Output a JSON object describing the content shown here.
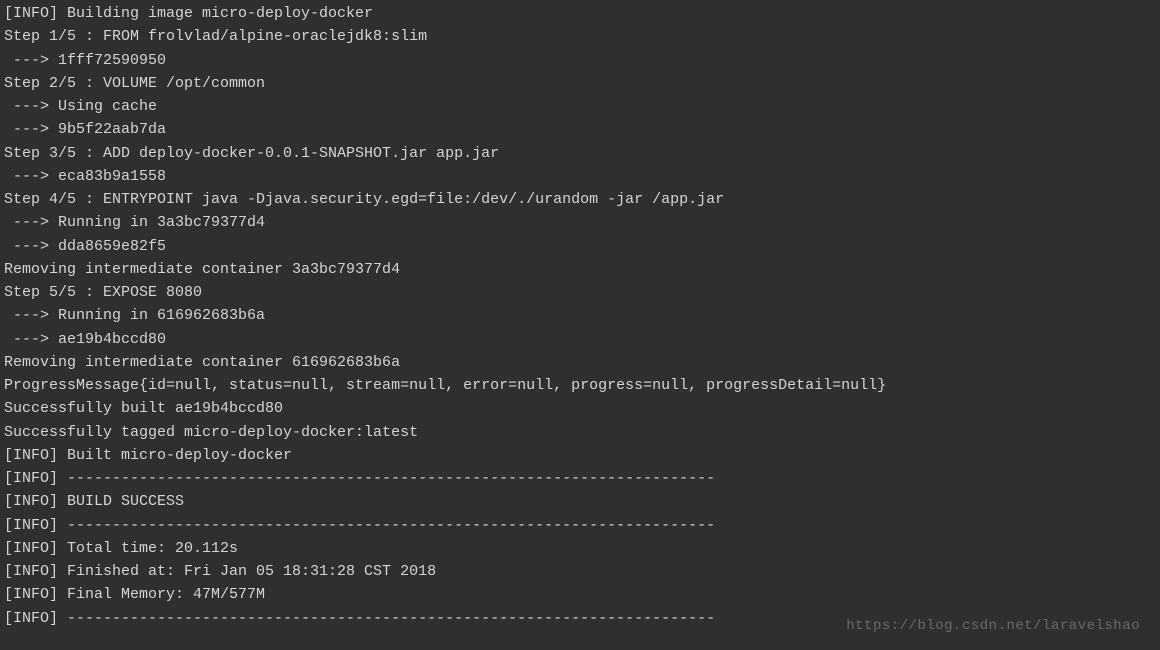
{
  "terminal": {
    "lines": [
      "[INFO] Building image micro-deploy-docker",
      "Step 1/5 : FROM frolvlad/alpine-oraclejdk8:slim",
      " ---> 1fff72590950",
      "Step 2/5 : VOLUME /opt/common",
      " ---> Using cache",
      " ---> 9b5f22aab7da",
      "Step 3/5 : ADD deploy-docker-0.0.1-SNAPSHOT.jar app.jar",
      " ---> eca83b9a1558",
      "Step 4/5 : ENTRYPOINT java -Djava.security.egd=file:/dev/./urandom -jar /app.jar",
      " ---> Running in 3a3bc79377d4",
      " ---> dda8659e82f5",
      "Removing intermediate container 3a3bc79377d4",
      "Step 5/5 : EXPOSE 8080",
      " ---> Running in 616962683b6a",
      " ---> ae19b4bccd80",
      "Removing intermediate container 616962683b6a",
      "ProgressMessage{id=null, status=null, stream=null, error=null, progress=null, progressDetail=null}",
      "Successfully built ae19b4bccd80",
      "Successfully tagged micro-deploy-docker:latest",
      "[INFO] Built micro-deploy-docker",
      "[INFO] ------------------------------------------------------------------------",
      "[INFO] BUILD SUCCESS",
      "[INFO] ------------------------------------------------------------------------",
      "[INFO] Total time: 20.112s",
      "[INFO] Finished at: Fri Jan 05 18:31:28 CST 2018",
      "[INFO] Final Memory: 47M/577M",
      "[INFO] ------------------------------------------------------------------------"
    ]
  },
  "watermark": "https://blog.csdn.net/laravelshao"
}
